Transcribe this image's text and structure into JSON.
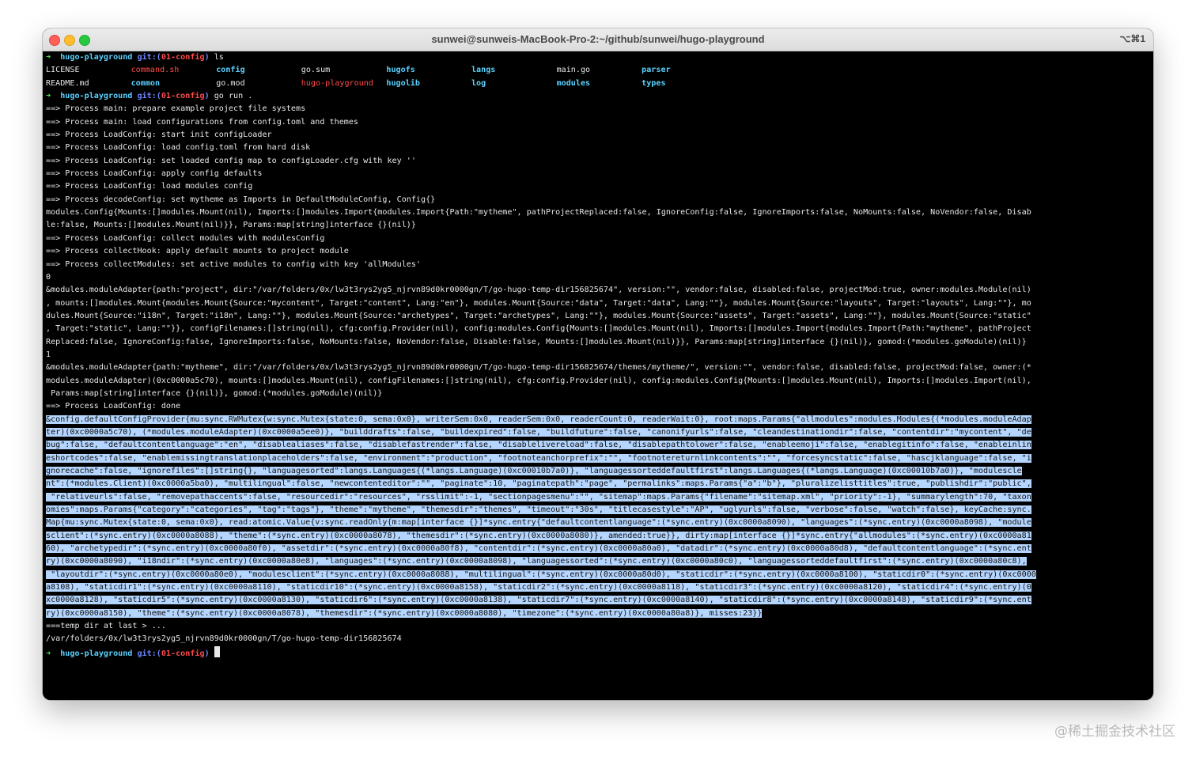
{
  "window": {
    "title": "sunwei@sunweis-MacBook-Pro-2:~/github/sunwei/hugo-playground",
    "shortcut": "⌥⌘1"
  },
  "prompt": {
    "arrow": "➜",
    "dir": "hugo-playground",
    "git_label": "git:(",
    "branch": "01-config",
    "git_close": ")"
  },
  "commands": {
    "first": "ls",
    "second": "go run ."
  },
  "ls_rows": [
    [
      "LICENSE",
      "command.sh",
      "config",
      "go.sum",
      "hugofs",
      "langs",
      "main.go",
      "parser"
    ],
    [
      "README.md",
      "common",
      "go.mod",
      "hugo-playground",
      "hugolib",
      "log",
      "modules",
      "types"
    ]
  ],
  "output_lines_a": [
    "==> Process main: prepare example project file systems",
    "==> Process main: load configurations from config.toml and themes",
    "==> Process LoadConfig: start init configLoader",
    "==> Process LoadConfig: load config.toml from hard disk",
    "==> Process LoadConfig: set loaded config map to configLoader.cfg with key ''",
    "==> Process LoadConfig: apply config defaults",
    "==> Process LoadConfig: load modules config",
    "==> Process decodeConfig: set mytheme as Imports in DefaultModuleConfig, Config{}",
    "modules.Config{Mounts:[]modules.Mount(nil), Imports:[]modules.Import{modules.Import{Path:\"mytheme\", pathProjectReplaced:false, IgnoreConfig:false, IgnoreImports:false, NoMounts:false, NoVendor:false, Disab",
    "le:false, Mounts:[]modules.Mount(nil)}}, Params:map[string]interface {}(nil)}",
    "==> Process LoadConfig: collect modules with modulesConfig",
    "==> Process collectHook: apply default mounts to project module",
    "==> Process collectModules: set active modules to config with key 'allModules'",
    "0",
    "&modules.moduleAdapter{path:\"project\", dir:\"/var/folders/0x/lw3t3rys2yg5_njrvn89d0kr0000gn/T/go-hugo-temp-dir156825674\", version:\"\", vendor:false, disabled:false, projectMod:true, owner:modules.Module(nil)",
    ", mounts:[]modules.Mount{modules.Mount{Source:\"mycontent\", Target:\"content\", Lang:\"en\"}, modules.Mount{Source:\"data\", Target:\"data\", Lang:\"\"}, modules.Mount{Source:\"layouts\", Target:\"layouts\", Lang:\"\"}, mo",
    "dules.Mount{Source:\"i18n\", Target:\"i18n\", Lang:\"\"}, modules.Mount{Source:\"archetypes\", Target:\"archetypes\", Lang:\"\"}, modules.Mount{Source:\"assets\", Target:\"assets\", Lang:\"\"}, modules.Mount{Source:\"static\"",
    ", Target:\"static\", Lang:\"\"}}, configFilenames:[]string(nil), cfg:config.Provider(nil), config:modules.Config{Mounts:[]modules.Mount(nil), Imports:[]modules.Import{modules.Import{Path:\"mytheme\", pathProject",
    "Replaced:false, IgnoreConfig:false, IgnoreImports:false, NoMounts:false, NoVendor:false, Disable:false, Mounts:[]modules.Mount(nil)}}, Params:map[string]interface {}(nil)}, gomod:(*modules.goModule)(nil)}",
    "1",
    "&modules.moduleAdapter{path:\"mytheme\", dir:\"/var/folders/0x/lw3t3rys2yg5_njrvn89d0kr0000gn/T/go-hugo-temp-dir156825674/themes/mytheme/\", version:\"\", vendor:false, disabled:false, projectMod:false, owner:(*",
    "modules.moduleAdapter)(0xc0000a5c70), mounts:[]modules.Mount(nil), configFilenames:[]string(nil), cfg:config.Provider(nil), config:modules.Config{Mounts:[]modules.Mount(nil), Imports:[]modules.Import(nil),",
    " Params:map[string]interface {}(nil)}, gomod:(*modules.goModule)(nil)}",
    "==> Process LoadConfig: done"
  ],
  "selected_lines": [
    "&config.defaultConfigProvider{mu:sync.RWMutex{w:sync.Mutex{state:0, sema:0x0}, writerSem:0x0, readerSem:0x0, readerCount:0, readerWait:0}, root:maps.Params{\"allmodules\":modules.Modules{(*modules.moduleAdap",
    "ter)(0xc0000a5c70), (*modules.moduleAdapter)(0xc0000a5ee0)}, \"builddrafts\":false, \"buildexpired\":false, \"buildfuture\":false, \"canonifyurls\":false, \"cleandestinationdir\":false, \"contentdir\":\"mycontent\", \"de",
    "bug\":false, \"defaultcontentlanguage\":\"en\", \"disablealiases\":false, \"disablefastrender\":false, \"disablelivereload\":false, \"disablepathtolower\":false, \"enableemoji\":false, \"enablegitinfo\":false, \"enableinlin",
    "eshortcodes\":false, \"enablemissingtranslationplaceholders\":false, \"environment\":\"production\", \"footnoteanchorprefix\":\"\", \"footnotereturnlinkcontents\":\"\", \"forcesyncstatic\":false, \"hascjklanguage\":false, \"i",
    "gnorecache\":false, \"ignorefiles\":[]string{}, \"languagesorted\":langs.Languages{(*langs.Language)(0xc00010b7a0)}, \"languagessorteddefaultfirst\":langs.Languages{(*langs.Language)(0xc00010b7a0)}, \"modulescle",
    "nt\":(*modules.Client)(0xc0000a5ba0), \"multilingual\":false, \"newcontenteditor\":\"\", \"paginate\":10, \"paginatepath\":\"page\", \"permalinks\":maps.Params{\"a\":\"b\"}, \"pluralizelisttitles\":true, \"publishdir\":\"public\",",
    " \"relativeurls\":false, \"removepathaccents\":false, \"resourcedir\":\"resources\", \"rsslimit\":-1, \"sectionpagesmenu\":\"\", \"sitemap\":maps.Params{\"filename\":\"sitemap.xml\", \"priority\":-1}, \"summarylength\":70, \"taxon",
    "omies\":maps.Params{\"category\":\"categories\", \"tag\":\"tags\"}, \"theme\":\"mytheme\", \"themesdir\":\"themes\", \"timeout\":\"30s\", \"titlecasestyle\":\"AP\", \"uglyurls\":false, \"verbose\":false, \"watch\":false}, keyCache:sync.",
    "Map{mu:sync.Mutex{state:0, sema:0x0}, read:atomic.Value{v:sync.readOnly{m:map[interface {}]*sync.entry{\"defaultcontentlanguage\":(*sync.entry)(0xc0000a8090), \"languages\":(*sync.entry)(0xc0000a8098), \"module",
    "sclient\":(*sync.entry)(0xc0000a8088), \"theme\":(*sync.entry)(0xc0000a8078), \"themesdir\":(*sync.entry)(0xc0000a8080)}, amended:true}}, dirty:map[interface {}]*sync.entry{\"allmodules\":(*sync.entry)(0xc0000a81",
    "60), \"archetypedir\":(*sync.entry)(0xc0000a80f0), \"assetdir\":(*sync.entry)(0xc0000a80f8), \"contentdir\":(*sync.entry)(0xc0000a80a0), \"datadir\":(*sync.entry)(0xc0000a80d8), \"defaultcontentlanguage\":(*sync.ent",
    "ry)(0xc0000a8090), \"i18ndir\":(*sync.entry)(0xc0000a80e8), \"languages\":(*sync.entry)(0xc0000a8098), \"languagessorted\":(*sync.entry)(0xc0000a80c0), \"languagessorteddefaultfirst\":(*sync.entry)(0xc0000a80c8),",
    " \"layoutdir\":(*sync.entry)(0xc0000a80e0), \"modulesclient\":(*sync.entry)(0xc0000a8088), \"multilingual\":(*sync.entry)(0xc0000a80d0), \"staticdir\":(*sync.entry)(0xc0000a8100), \"staticdir0\":(*sync.entry)(0xc0000",
    "a8108), \"staticdir1\":(*sync.entry)(0xc0000a8110), \"staticdir10\":(*sync.entry)(0xc0000a8158), \"staticdir2\":(*sync.entry)(0xc0000a8118), \"staticdir3\":(*sync.entry)(0xc0000a8120), \"staticdir4\":(*sync.entry)(0",
    "xc0000a8128), \"staticdir5\":(*sync.entry)(0xc0000a8130), \"staticdir6\":(*sync.entry)(0xc0000a8138), \"staticdir7\":(*sync.entry)(0xc0000a8140), \"staticdir8\":(*sync.entry)(0xc0000a8148), \"staticdir9\":(*sync.ent",
    "ry)(0xc0000a8150), \"theme\":(*sync.entry)(0xc0000a8078), \"themesdir\":(*sync.entry)(0xc0000a8080), \"timezone\":(*sync.entry)(0xc0000a80a8)}, misses:23}}"
  ],
  "output_lines_b": [
    "===temp dir at last > ...",
    "/var/folders/0x/lw3t3rys2yg5_njrvn89d0kr0000gn/T/go-hugo-temp-dir156825674"
  ],
  "watermark": "@稀土掘金技术社区",
  "colors": {
    "prompt_arrow": "#54f054",
    "dir": "#5ad2ff",
    "git": "#6e87ff",
    "branch": "#ff4b4b",
    "selection": "#b4d5fe"
  }
}
